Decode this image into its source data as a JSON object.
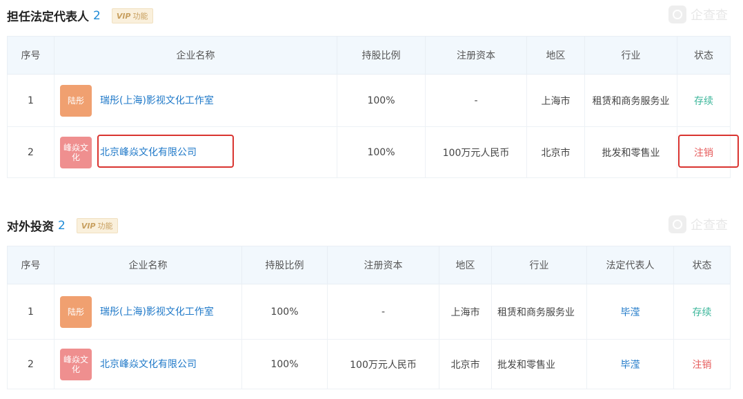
{
  "section1": {
    "title": "担任法定代表人",
    "count": "2",
    "vip_badge": "VIP",
    "vip_label": "功能",
    "watermark": "企查查",
    "headers": [
      "序号",
      "企业名称",
      "持股比例",
      "注册资本",
      "地区",
      "行业",
      "状态"
    ],
    "rows": [
      {
        "index": "1",
        "logo": "陆彤",
        "name": "瑞彤(上海)影视文化工作室",
        "share": "100%",
        "capital": "-",
        "region": "上海市",
        "industry": "租赁和商务服务业",
        "status": "存续"
      },
      {
        "index": "2",
        "logo": "峰焱文化",
        "name": "北京峰焱文化有限公司",
        "share": "100%",
        "capital": "100万元人民币",
        "region": "北京市",
        "industry": "批发和零售业",
        "status": "注销"
      }
    ]
  },
  "section2": {
    "title": "对外投资",
    "count": "2",
    "vip_badge": "VIP",
    "vip_label": "功能",
    "watermark": "企查查",
    "headers": [
      "序号",
      "企业名称",
      "持股比例",
      "注册资本",
      "地区",
      "行业",
      "法定代表人",
      "状态"
    ],
    "rows": [
      {
        "index": "1",
        "logo": "陆彤",
        "name": "瑞彤(上海)影视文化工作室",
        "share": "100%",
        "capital": "-",
        "region": "上海市",
        "industry": "租赁和商务服务业",
        "legal_rep": "毕滢",
        "status": "存续"
      },
      {
        "index": "2",
        "logo": "峰焱文化",
        "name": "北京峰焱文化有限公司",
        "share": "100%",
        "capital": "100万元人民币",
        "region": "北京市",
        "industry": "批发和零售业",
        "legal_rep": "毕滢",
        "status": "注销"
      }
    ]
  },
  "colors": {
    "accent": "#1e78c8",
    "status_ok": "#3bb69a",
    "status_cancel": "#e65a5a",
    "highlight": "#d9332f"
  }
}
